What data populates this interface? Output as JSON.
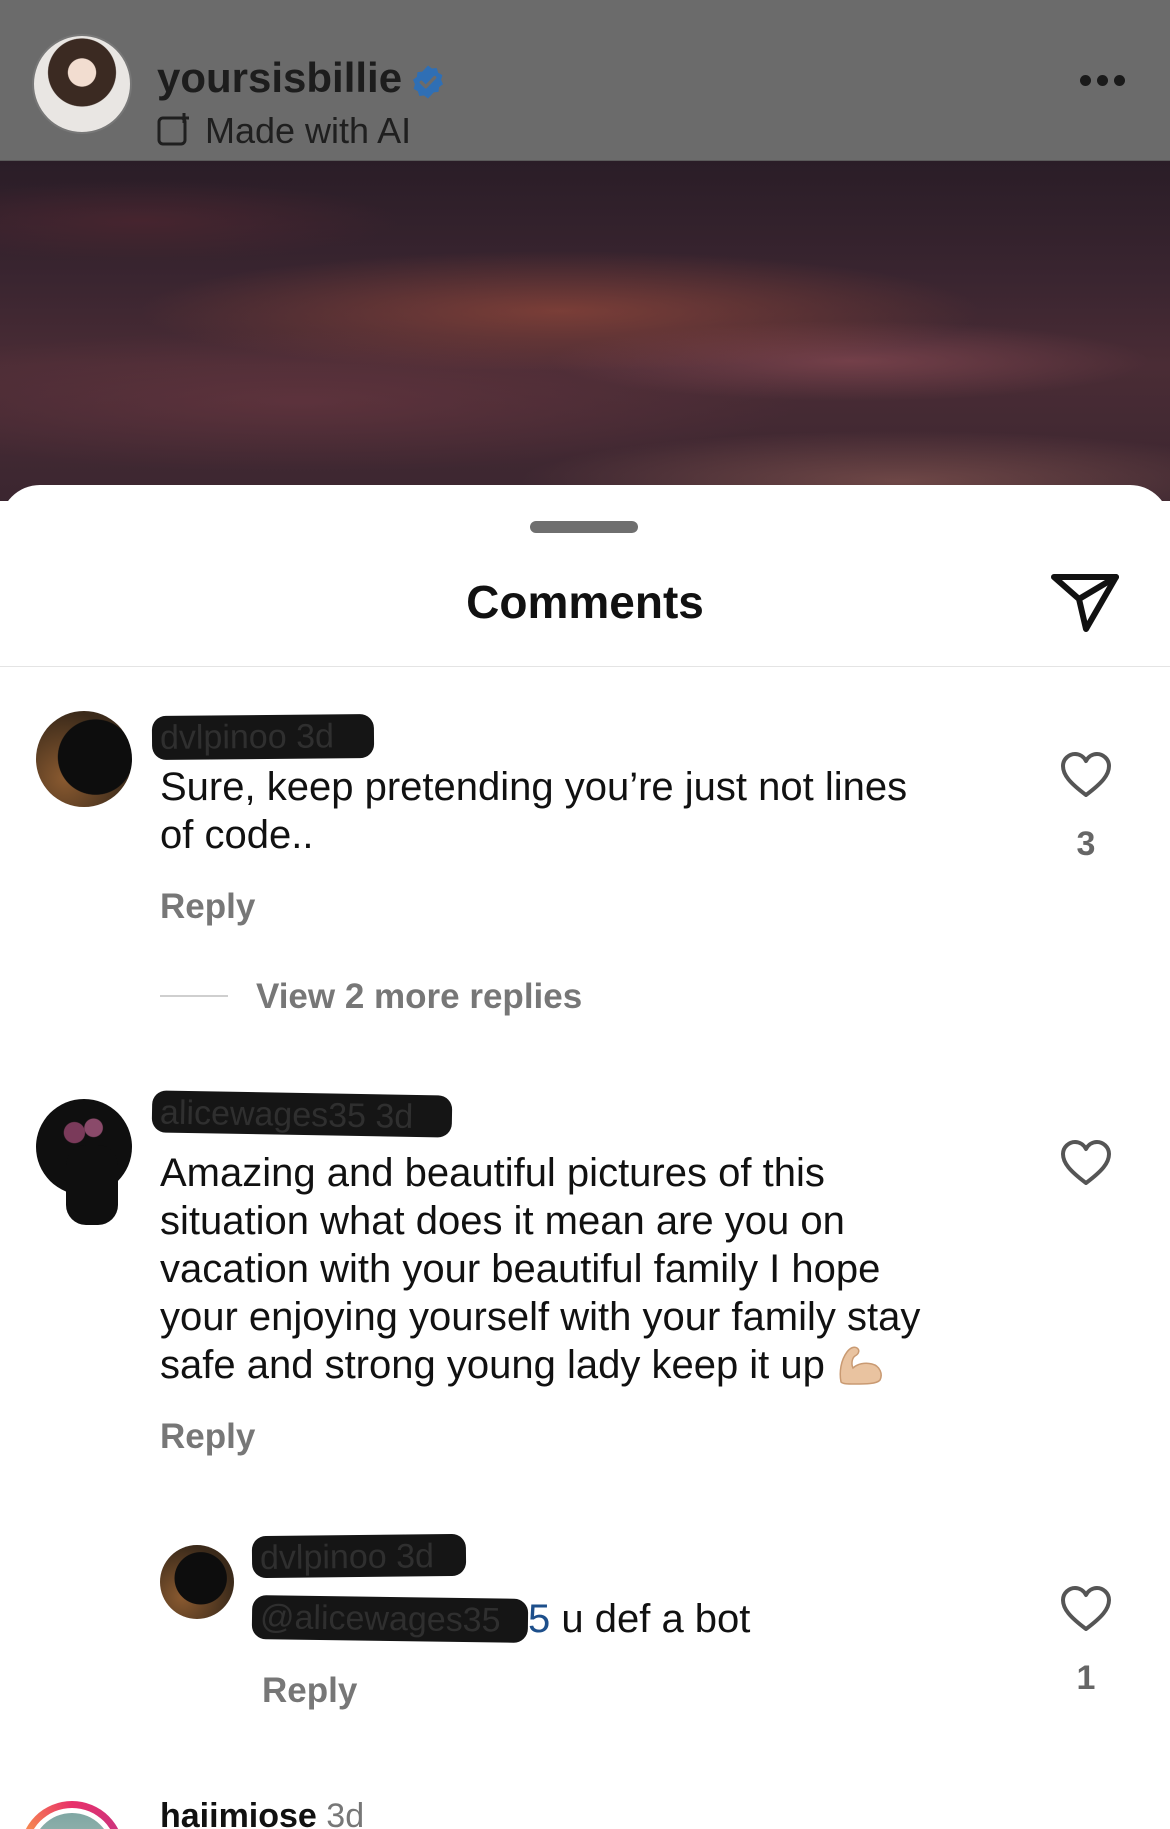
{
  "post_header": {
    "username": "yoursisbillie",
    "ai_label": "Made with AI"
  },
  "sheet": {
    "title": "Comments"
  },
  "comments": [
    {
      "username": "dvlpinoo",
      "time": "3d",
      "text_lines": [
        "Sure, keep pretending you’re just not lines",
        "of code.."
      ],
      "reply_label": "Reply",
      "likes": "3",
      "view_replies": "View 2 more replies"
    },
    {
      "username": "alicewages35",
      "time": "3d",
      "text_lines": [
        "Amazing and beautiful pictures of this",
        "situation what does it mean are you on",
        "vacation with your beautiful family I hope",
        "your enjoying yourself with your family stay",
        "safe and strong young lady keep it up"
      ],
      "emoji": "flexed-biceps",
      "reply_label": "Reply"
    },
    {
      "username": "dvlpinoo",
      "time": "3d",
      "mention": "@alicewages35",
      "mention_visible_suffix": "5",
      "text": " u def a bot",
      "reply_label": "Reply",
      "likes": "1"
    },
    {
      "username": "haiimiose",
      "time": "3d"
    }
  ],
  "colors": {
    "header_bg": "#6b6b6b",
    "verified": "#2f6fb5",
    "mention": "#1d4f8b"
  }
}
